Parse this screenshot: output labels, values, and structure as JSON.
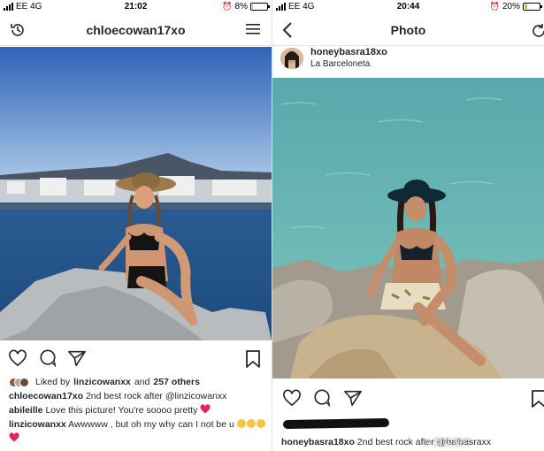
{
  "left": {
    "status": {
      "carrier": "EE",
      "network": "4G",
      "time": "21:02",
      "battery": "8%",
      "battery_level": 0.08
    },
    "header": {
      "title": "chloecowan17xo"
    },
    "likes": {
      "label": "Liked by",
      "user": "linzicowanxx",
      "and": "and",
      "others": "257 others"
    },
    "caption": {
      "user": "chloecowan17xo",
      "text": "2nd best rock after @linzicowanxx"
    },
    "comments": [
      {
        "user": "abileille",
        "text": "Love this picture! You're soooo pretty"
      },
      {
        "user": "linzicowanxx",
        "text": "Awwwww , but oh my why can I not be u"
      }
    ],
    "icons": [
      "history-icon",
      "menu-icon",
      "heart-icon",
      "comment-icon",
      "share-icon",
      "bookmark-icon"
    ]
  },
  "right": {
    "status": {
      "carrier": "EE",
      "network": "4G",
      "time": "20:44",
      "battery": "20%",
      "battery_level": 0.2
    },
    "header": {
      "title": "Photo"
    },
    "post": {
      "user": "honeybasra18xo",
      "location": "La Barceloneta"
    },
    "caption": {
      "user": "honeybasra18xo",
      "text": "2nd best rock after @balbasraxx"
    },
    "icons": [
      "back-icon",
      "refresh-icon",
      "heart-icon",
      "comment-icon",
      "share-icon",
      "bookmark-icon"
    ]
  },
  "watermark": {
    "text": "真实案件"
  },
  "colors": {
    "heart_emoji": "#e0245e",
    "sky": "#3a73c4",
    "sea": "#5fb8b0",
    "battery_low": "#f0b400"
  }
}
